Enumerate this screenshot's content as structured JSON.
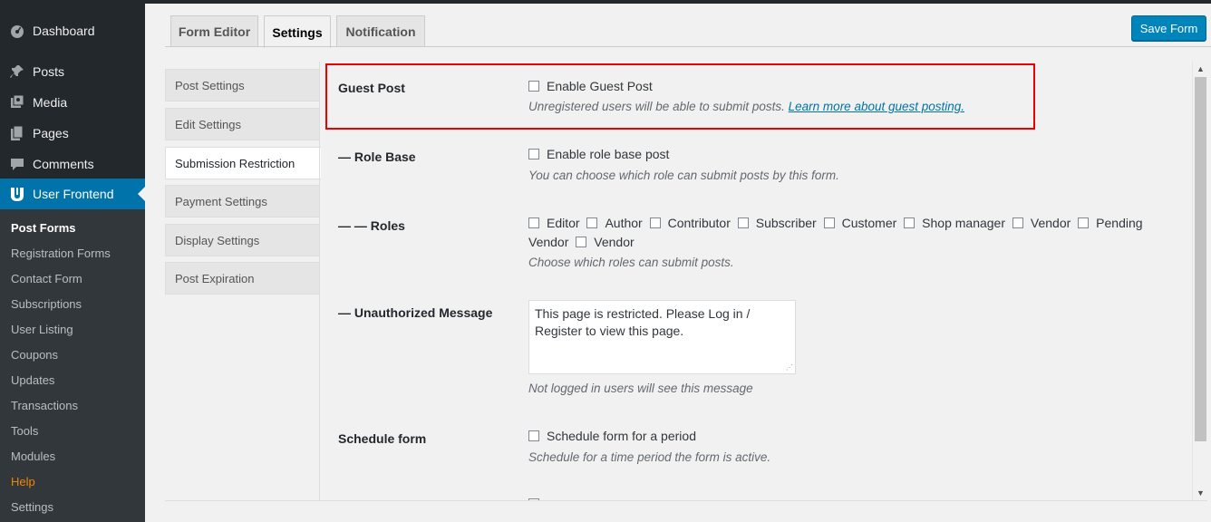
{
  "sidebar": {
    "top_items": [
      {
        "label": "Dashboard",
        "icon": "dashboard-icon"
      },
      {
        "label": "Posts",
        "icon": "pin-icon"
      },
      {
        "label": "Media",
        "icon": "media-icon"
      },
      {
        "label": "Pages",
        "icon": "pages-icon"
      },
      {
        "label": "Comments",
        "icon": "comments-icon"
      },
      {
        "label": "User Frontend",
        "icon": "user-frontend-logo-icon"
      }
    ],
    "submenu": [
      "Post Forms",
      "Registration Forms",
      "Contact Form",
      "Subscriptions",
      "User Listing",
      "Coupons",
      "Updates",
      "Transactions",
      "Tools",
      "Modules",
      "Help",
      "Settings"
    ]
  },
  "tabs": [
    "Form Editor",
    "Settings",
    "Notification"
  ],
  "toolbar": {
    "save_label": "Save Form"
  },
  "settings_nav": [
    "Post Settings",
    "Edit Settings",
    "Submission Restriction",
    "Payment Settings",
    "Display Settings",
    "Post Expiration"
  ],
  "content": {
    "guest_post": {
      "label": "Guest Post",
      "checkbox_label": "Enable Guest Post",
      "desc": "Unregistered users will be able to submit posts.",
      "link": "Learn more about guest posting."
    },
    "role_base": {
      "label": "— Role Base",
      "checkbox_label": "Enable role base post",
      "desc": "You can choose which role can submit posts by this form."
    },
    "roles": {
      "label": "— — Roles",
      "options": [
        "Editor",
        "Author",
        "Contributor",
        "Subscriber",
        "Customer",
        "Shop manager",
        "Vendor",
        "Pending Vendor",
        "Vendor"
      ],
      "desc": "Choose which roles can submit posts."
    },
    "unauthorized": {
      "label": "— Unauthorized Message",
      "value": "This page is restricted. Please Log in / Register to view this page.",
      "desc": "Not logged in users will see this message"
    },
    "schedule": {
      "label": "Schedule form",
      "checkbox_label": "Schedule form for a period",
      "desc": "Schedule for a time period the form is active."
    }
  },
  "colors": {
    "accent": "#0073aa",
    "highlight_box": "#e00000",
    "help": "#f18500"
  }
}
